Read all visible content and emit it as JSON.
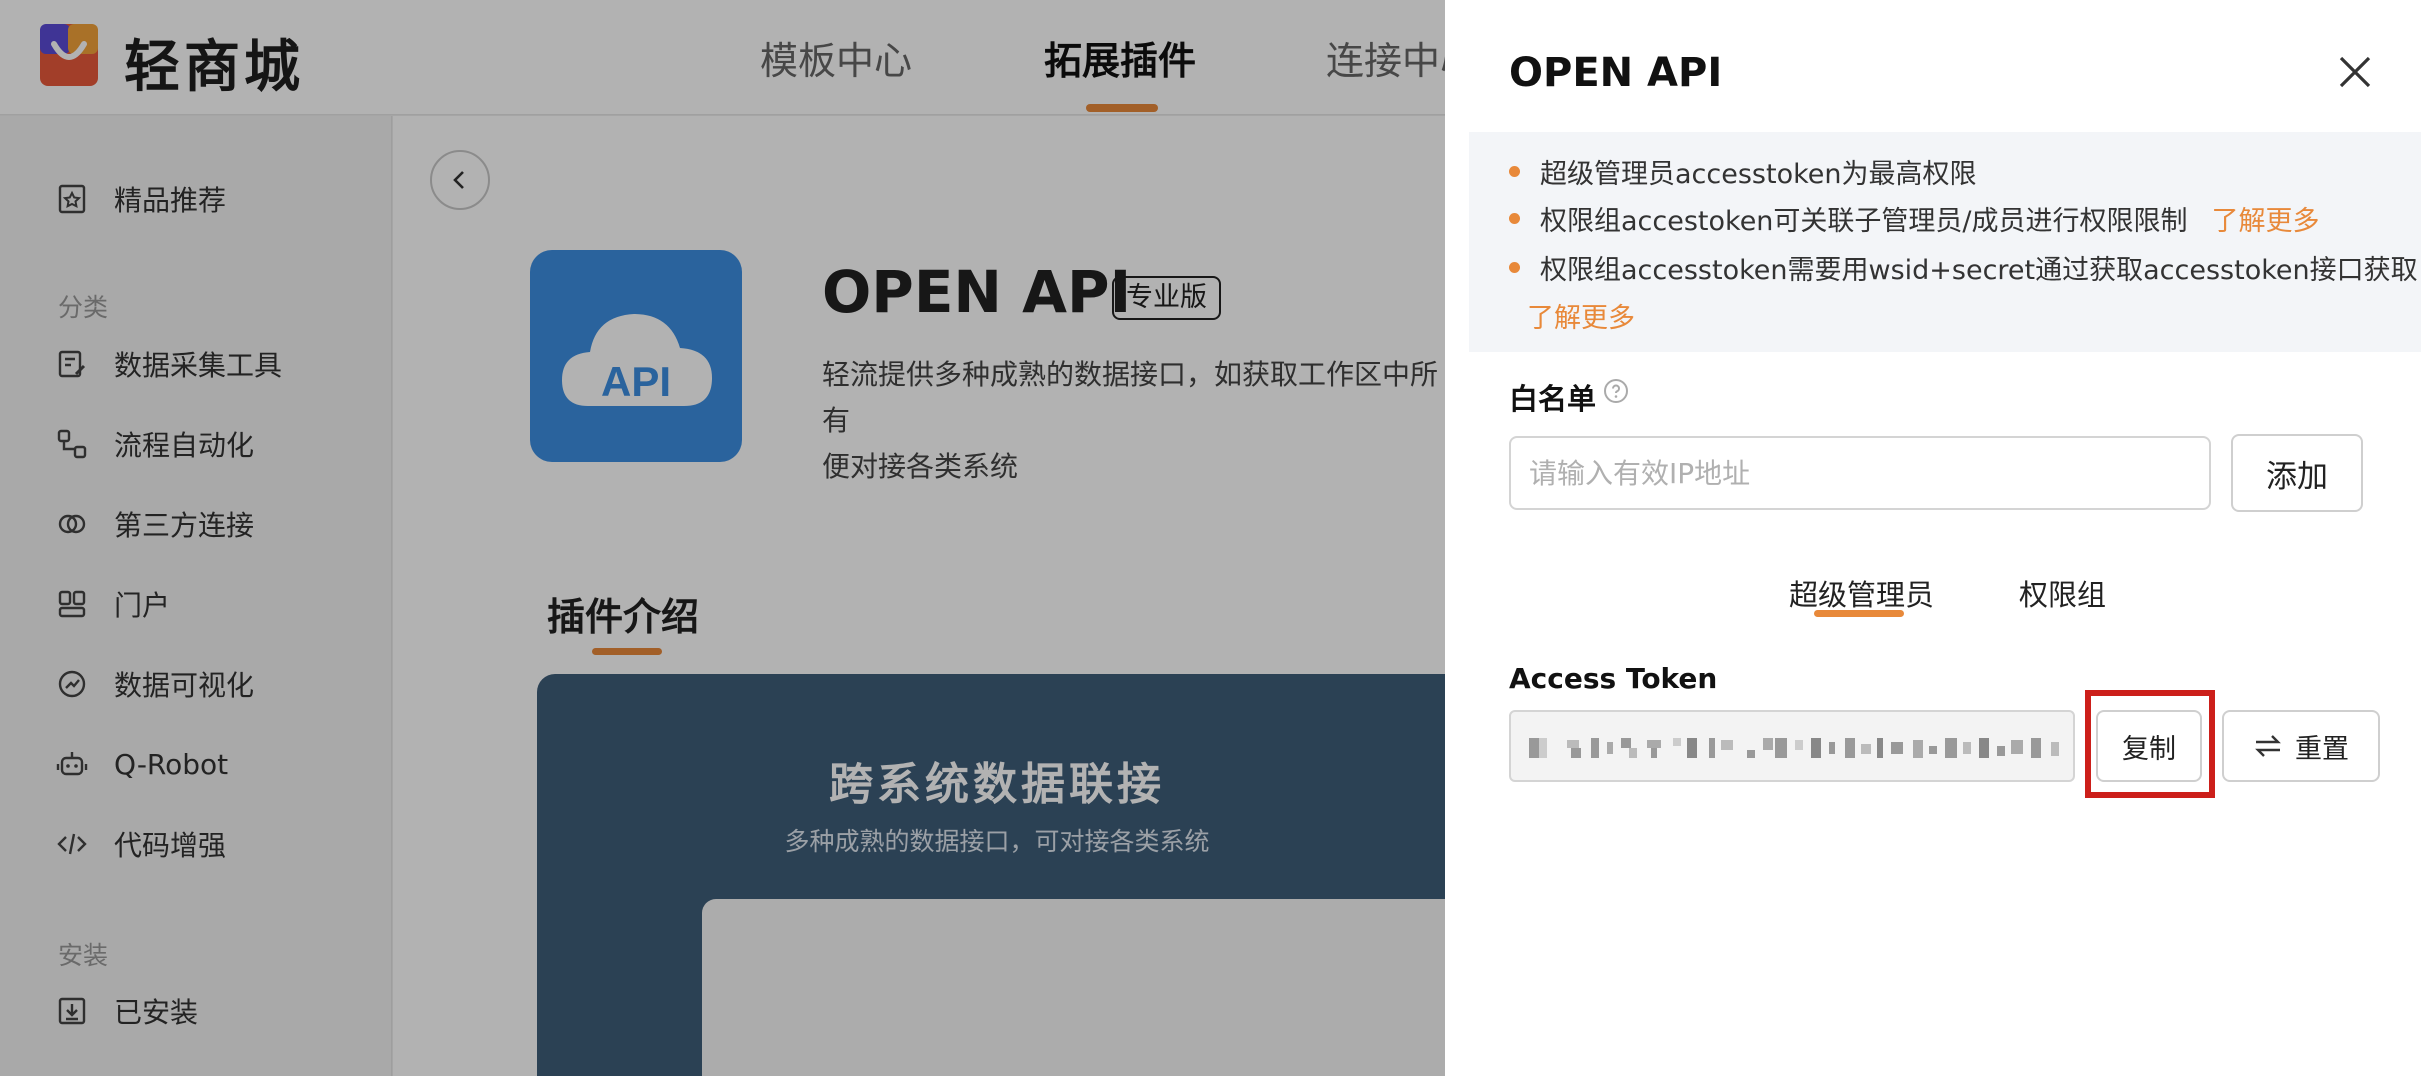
{
  "header": {
    "brand": "轻商城",
    "nav": [
      {
        "label": "模板中心"
      },
      {
        "label": "拓展插件",
        "active": true
      },
      {
        "label": "连接中心"
      }
    ]
  },
  "sidebar": {
    "top_item": {
      "label": "精品推荐",
      "icon": "star-bookmark-icon"
    },
    "group_category": "分类",
    "items": [
      {
        "label": "数据采集工具",
        "icon": "form-edit-icon"
      },
      {
        "label": "流程自动化",
        "icon": "flow-icon"
      },
      {
        "label": "第三方连接",
        "icon": "link-icon"
      },
      {
        "label": "门户",
        "icon": "portal-icon"
      },
      {
        "label": "数据可视化",
        "icon": "gauge-icon"
      },
      {
        "label": "Q-Robot",
        "icon": "robot-icon"
      },
      {
        "label": "代码增强",
        "icon": "code-icon"
      }
    ],
    "group_install": "安装",
    "installed": {
      "label": "已安装",
      "icon": "download-box-icon"
    }
  },
  "plugin": {
    "icon_text": "API",
    "title": "OPEN API",
    "badge": "专业版",
    "description": "轻流提供多种成熟的数据接口，如获取工作区中所有\n便对接各类系统",
    "section_title": "插件介绍",
    "banner_title": "跨系统数据联接",
    "banner_subtitle": "多种成熟的数据接口，可对接各类系统"
  },
  "drawer": {
    "title": "OPEN API",
    "notices": [
      {
        "text": "超级管理员accesstoken为最高权限"
      },
      {
        "text": "权限组accestoken可关联子管理员/成员进行权限限制",
        "link": "了解更多"
      },
      {
        "text": "权限组accesstoken需要用wsid+secret通过获取accesstoken接口获取",
        "link": "了解更多"
      }
    ],
    "whitelist": {
      "label": "白名单",
      "placeholder": "请输入有效IP地址",
      "add_label": "添加"
    },
    "tabs": [
      {
        "label": "超级管理员",
        "active": true
      },
      {
        "label": "权限组"
      }
    ],
    "access_token": {
      "label": "Access Token",
      "copy_label": "复制",
      "reset_label": "重置"
    }
  },
  "colors": {
    "accent": "#e8893a",
    "highlight": "#cc1f1a",
    "icon_blue": "#3d8fe1",
    "banner": "#3e5d79"
  }
}
